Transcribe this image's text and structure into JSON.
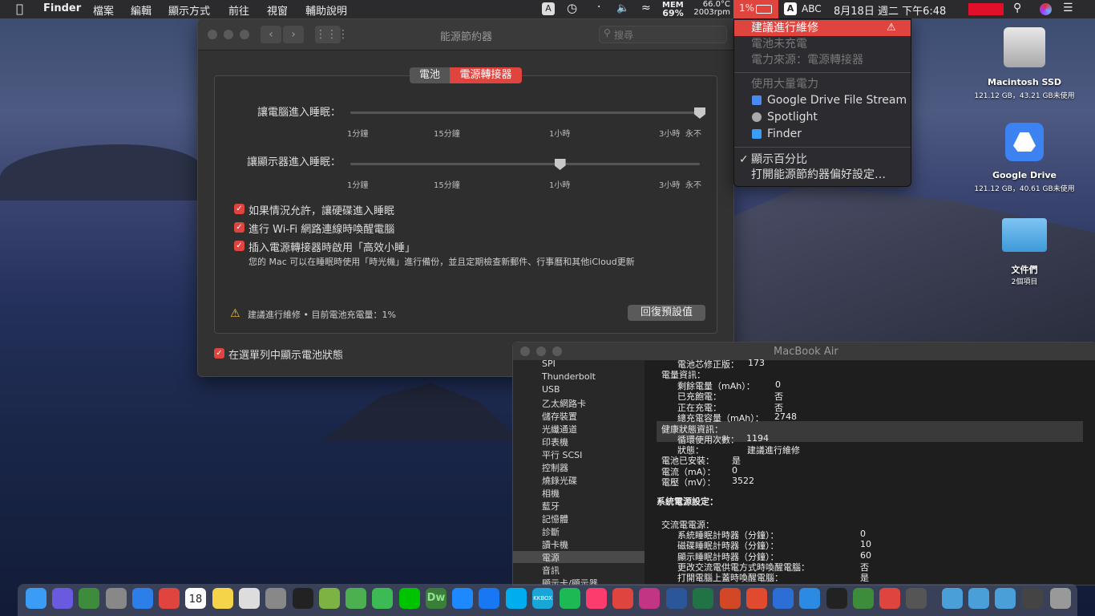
{
  "menubar": {
    "apple": "",
    "app": "Finder",
    "menus": [
      "檔案",
      "編輯",
      "顯示方式",
      "前往",
      "視窗",
      "輔助說明"
    ],
    "mem_label": "MEM",
    "mem_value": "69%",
    "temp": "66.0°C",
    "rpm": "2003rpm",
    "battery_pct": "1%",
    "input_a": "A",
    "input_abc": "ABC",
    "clock": "8月18日 週二 下午6:48"
  },
  "prefs": {
    "title": "能源節約器",
    "search_placeholder": "搜尋",
    "tabs": [
      "電池",
      "電源轉接器"
    ],
    "computer_sleep_label": "讓電腦進入睡眠：",
    "display_sleep_label": "讓顯示器進入睡眠：",
    "tick_labels": [
      "1分鐘",
      "15分鐘",
      "1小時",
      "3小時",
      "永不"
    ],
    "computer_sleep_level": 1.0,
    "display_sleep_level": 0.6,
    "checks": [
      "如果情況允許，讓硬碟進入睡眠",
      "進行 Wi-Fi 網路連線時喚醒電腦",
      "插入電源轉接器時啟用「高效小睡」"
    ],
    "powernap_desc": "您的 Mac 可以在睡眠時使用「時光機」進行備份，並且定期檢查新郵件、行事曆和其他iCloud更新",
    "warning_text": "建議進行維修 • 目前電池充電量：1%",
    "restore_button": "回復預設值",
    "show_status_label": "在選單列中顯示電池狀態"
  },
  "battery_menu": {
    "service": "建議進行維修",
    "not_charging": "電池未充電",
    "source": "電力來源：電源轉接器",
    "heavy_use_title": "使用大量電力",
    "apps": [
      "Google Drive File Stream",
      "Spotlight",
      "Finder"
    ],
    "show_percent": "顯示百分比",
    "open_prefs": "打開能源節約器偏好設定…"
  },
  "desktop": {
    "ssd_name": "Macintosh SSD",
    "ssd_info": "121.12 GB，43.21 GB未使用",
    "gdrive_name": "Google Drive",
    "gdrive_info": "121.12 GB，40.61 GB未使用",
    "docs_name": "文件們",
    "docs_info": "2個項目"
  },
  "sysinfo": {
    "title": "MacBook Air",
    "sidebar": [
      "SPI",
      "Thunderbolt",
      "USB",
      "乙太網路卡",
      "儲存裝置",
      "光纖通道",
      "印表機",
      "平行 SCSI",
      "控制器",
      "燒錄光碟",
      "相機",
      "藍牙",
      "記憶體",
      "診斷",
      "讀卡機",
      "電源",
      "音訊",
      "顯示卡/顯示器"
    ],
    "selected_index": 15,
    "details": [
      {
        "k": "電池芯修正版：",
        "v": "173"
      },
      {
        "k": "電量資訊：",
        "v": ""
      },
      {
        "k": "剩餘電量（mAh）：",
        "v": "0"
      },
      {
        "k": "已充飽電：",
        "v": "否"
      },
      {
        "k": "正在充電：",
        "v": "否"
      },
      {
        "k": "總充電容量（mAh）：",
        "v": "2748"
      },
      {
        "k": "健康狀態資訊：",
        "v": ""
      },
      {
        "k": "循環使用次數：",
        "v": "1194"
      },
      {
        "k": "狀態：",
        "v": "建議進行維修"
      },
      {
        "k": "電池已安裝：",
        "v": "是"
      },
      {
        "k": "電流（mA）：",
        "v": "0"
      },
      {
        "k": "電壓（mV）：",
        "v": "3522"
      },
      {
        "k": "系統電源設定：",
        "v": ""
      },
      {
        "k": "交流電電源：",
        "v": ""
      },
      {
        "k": "系統睡眠計時器（分鐘）：",
        "v": "0"
      },
      {
        "k": "磁碟睡眠計時器（分鐘）：",
        "v": "10"
      },
      {
        "k": "顯示睡眠計時器（分鐘）：",
        "v": "60"
      },
      {
        "k": "更改交流電供電方式時喚醒電腦：",
        "v": "否"
      },
      {
        "k": "打開電腦上蓋時喚醒電腦：",
        "v": "是"
      }
    ]
  },
  "dock": {
    "calendar_day": "18",
    "app_labels": [
      "Dw",
      "KKBOX"
    ]
  },
  "colors": {
    "accent_red": "#e0443e",
    "menu_highlight": "#e0443e"
  }
}
